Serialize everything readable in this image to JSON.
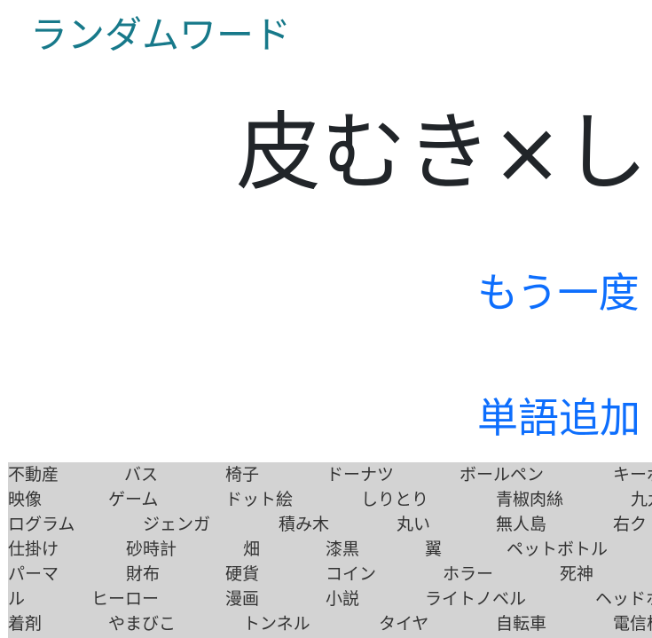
{
  "header": {
    "title": "ランダムワード"
  },
  "result": {
    "text": "皮むき×しい"
  },
  "actions": {
    "again_label": "もう一度",
    "add_label": "単語追加"
  },
  "word_list": {
    "rows": [
      [
        "不動産",
        "バス",
        "椅子",
        "ドーナツ",
        "ボールペン",
        "キーボ"
      ],
      [
        "映像",
        "ゲーム",
        "ドット絵",
        "しりとり",
        "青椒肉絲",
        "九九"
      ],
      [
        "ログラム",
        "ジェンガ",
        "積み木",
        "丸い",
        "無人島",
        "右ク"
      ],
      [
        "仕掛け",
        "砂時計",
        "畑",
        "漆黒",
        "翼",
        "ペットボトル"
      ],
      [
        "パーマ",
        "財布",
        "硬貨",
        "コイン",
        "ホラー",
        "死神"
      ],
      [
        "ル",
        "ヒーロー",
        "漫画",
        "小説",
        "ライトノベル",
        "ヘッドホ"
      ],
      [
        "着剤",
        "やまびこ",
        "トンネル",
        "タイヤ",
        "自転車",
        "電信柱"
      ]
    ]
  }
}
